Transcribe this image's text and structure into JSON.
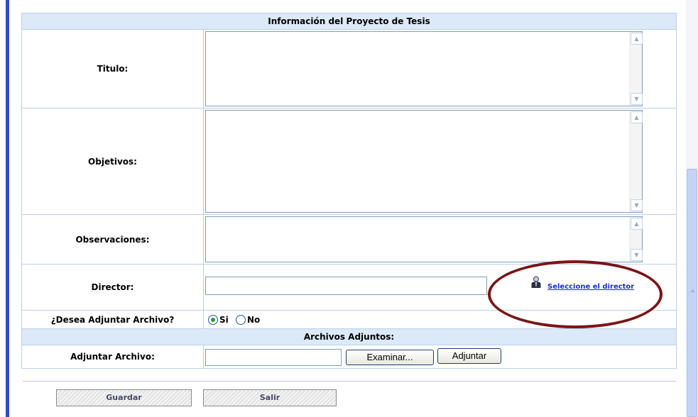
{
  "section_title": "Información del Proyecto de Tesis",
  "fields": {
    "titulo_label": "Titulo:",
    "objetivos_label": "Objetivos:",
    "observaciones_label": "Observaciones:",
    "director_label": "Director:",
    "director_link": "Seleccione el director",
    "adjuntar_question": "¿Desea Adjuntar Archivo?",
    "radio_si": "Si",
    "radio_no": "No",
    "radio_selected": "Si"
  },
  "attachments": {
    "section_title": "Archivos Adjuntos:",
    "label": "Adjuntar Archivo:",
    "browse_button": "Examinar...",
    "attach_button": "Adjuntar"
  },
  "actions": {
    "save_button": "Guardar",
    "exit_button": "Salir"
  },
  "colors": {
    "header_bg": "#dce9f8",
    "border": "#b9cfe8",
    "link": "#1a2dd6",
    "highlight": "#7a1515"
  },
  "icons": {
    "director": "person-icon",
    "scroll_up": "chevron-up-icon",
    "scroll_down": "chevron-down-icon"
  }
}
